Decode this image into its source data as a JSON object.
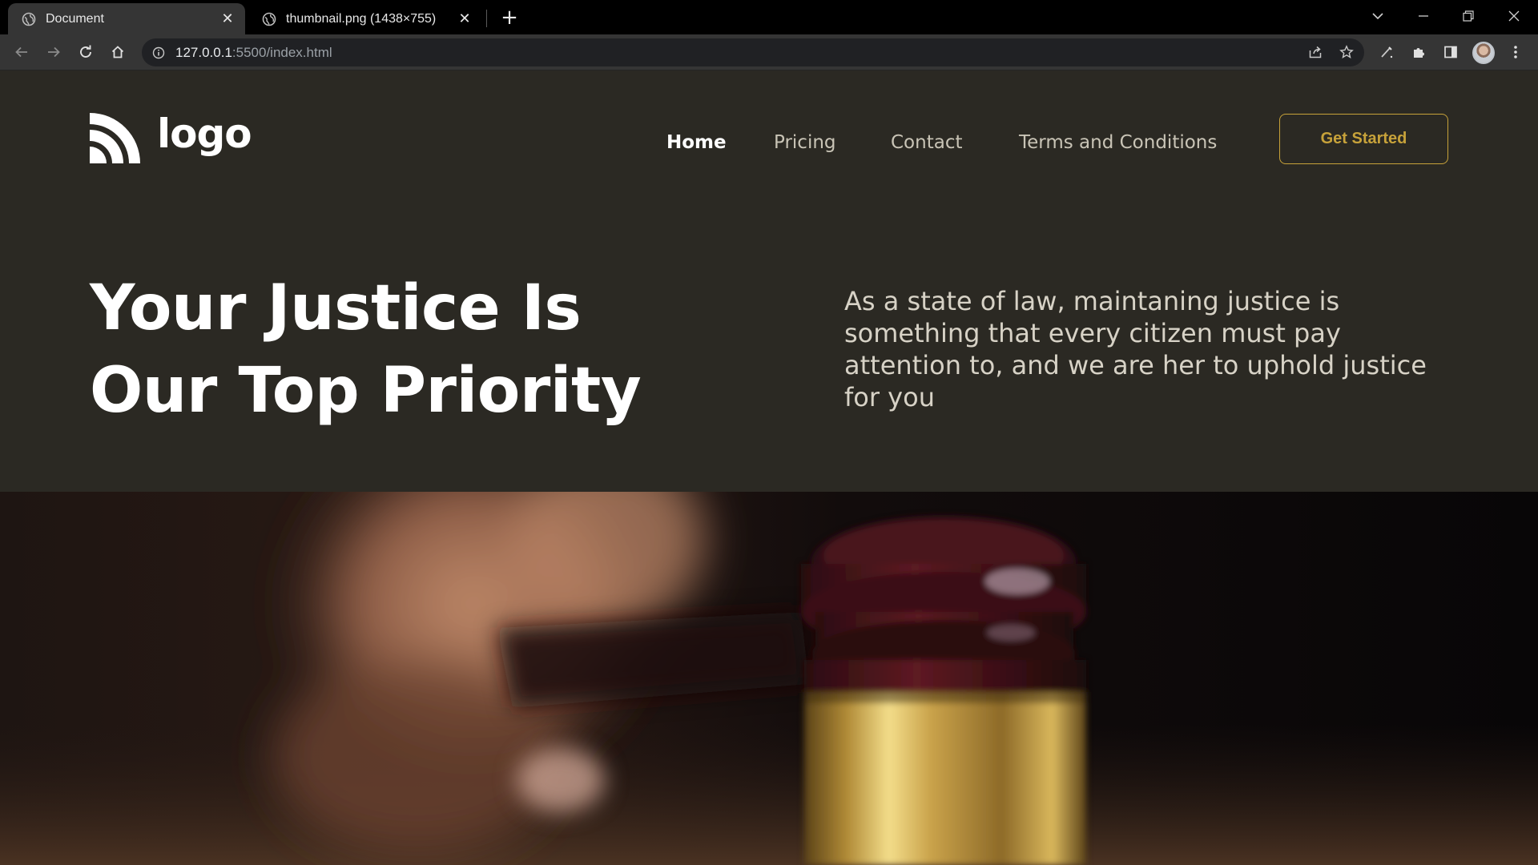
{
  "browser": {
    "tabs": [
      {
        "title": "Document",
        "active": true
      },
      {
        "title": "thumbnail.png (1438×755)",
        "active": false
      }
    ],
    "address": {
      "host": "127.0.0.1",
      "rest": ":5500/index.html"
    }
  },
  "site": {
    "logo_text": "logo",
    "nav": [
      {
        "label": "Home",
        "active": true
      },
      {
        "label": "Pricing",
        "active": false
      },
      {
        "label": "Contact",
        "active": false
      },
      {
        "label": "Terms and Conditions",
        "active": false
      }
    ],
    "cta_label": "Get Started",
    "hero_line1": "Your Justice Is",
    "hero_line2": "Our Top Priority",
    "hero_description": "As a state of law, maintaning justice is something that every citizen must pay attention to, and we are her to uphold justice for you"
  },
  "colors": {
    "page_background": "#2b2923",
    "accent_gold": "#c7a23a",
    "nav_inactive": "#c9c4b6"
  }
}
